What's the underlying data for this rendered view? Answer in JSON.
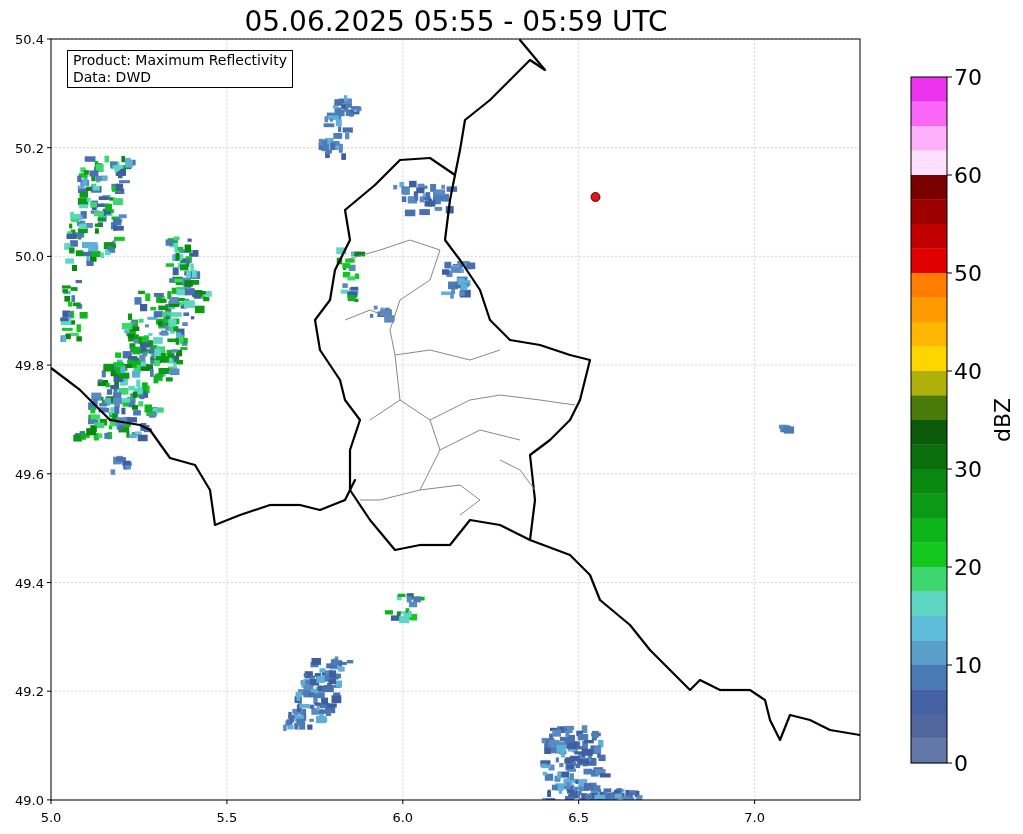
{
  "title": "05.06.2025 05:55 - 05:59 UTC",
  "info_box": {
    "lines": [
      "Product: Maximum Reflectivity",
      "Data: DWD"
    ]
  },
  "x_axis": {
    "ticks": [
      "5.0",
      "5.5",
      "6.0",
      "6.5",
      "7.0"
    ]
  },
  "y_axis": {
    "ticks": [
      "50.4",
      "50.2",
      "50.0",
      "49.8",
      "49.6",
      "49.4",
      "49.2",
      "49.0"
    ]
  },
  "colorbar": {
    "label": "dBZ",
    "ticks": [
      "70",
      "60",
      "50",
      "40",
      "30",
      "20",
      "10",
      "0"
    ],
    "segments": [
      {
        "color": "#ee33ee"
      },
      {
        "color": "#fa66f8"
      },
      {
        "color": "#ffb0fb"
      },
      {
        "color": "#ffe0fc"
      },
      {
        "color": "#7a0000"
      },
      {
        "color": "#9c0000"
      },
      {
        "color": "#c00000"
      },
      {
        "color": "#e00000"
      },
      {
        "color": "#ff7d00"
      },
      {
        "color": "#ff9a00"
      },
      {
        "color": "#ffb600"
      },
      {
        "color": "#ffd500"
      },
      {
        "color": "#b0b00a"
      },
      {
        "color": "#4a7a0a"
      },
      {
        "color": "#0a5a0a"
      },
      {
        "color": "#0a6e0a"
      },
      {
        "color": "#0a870f"
      },
      {
        "color": "#0a9a14"
      },
      {
        "color": "#0db41a"
      },
      {
        "color": "#12c81e"
      },
      {
        "color": "#3ed66e"
      },
      {
        "color": "#5dd6c4"
      },
      {
        "color": "#5fbddc"
      },
      {
        "color": "#5a9fca"
      },
      {
        "color": "#4a7ab5"
      },
      {
        "color": "#4560a5"
      },
      {
        "color": "#52669e"
      },
      {
        "color": "#6378a8"
      }
    ]
  }
}
